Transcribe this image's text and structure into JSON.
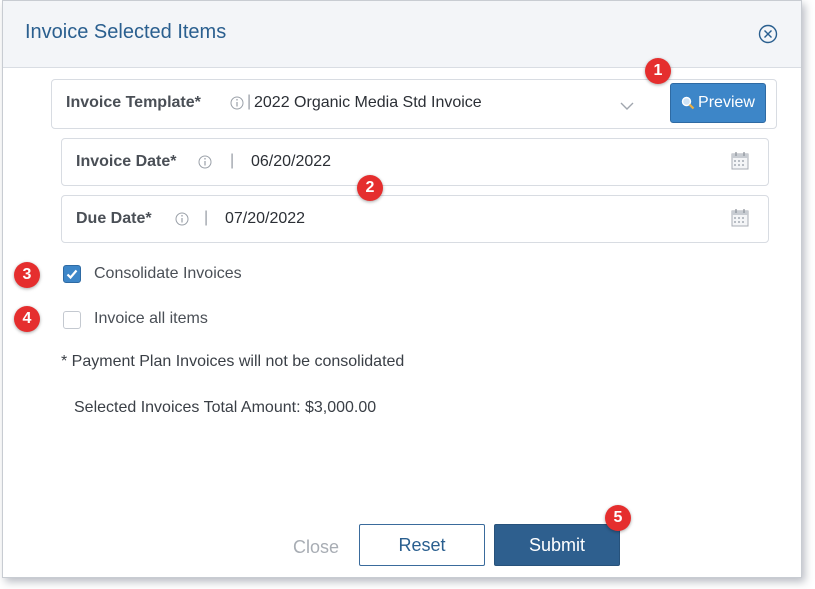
{
  "dialog": {
    "title": "Invoice Selected Items"
  },
  "template_field": {
    "label": "Invoice Template*",
    "value": "2022 Organic Media Std Invoice",
    "preview_label": "Preview"
  },
  "invoice_date": {
    "label": "Invoice Date*",
    "separator": "|",
    "value": "06/20/2022"
  },
  "due_date": {
    "label": "Due Date*",
    "separator": "|",
    "value": "07/20/2022"
  },
  "options": {
    "consolidate_label": "Consolidate Invoices",
    "consolidate_checked": true,
    "invoice_all_label": "Invoice all items",
    "invoice_all_checked": false
  },
  "notes": {
    "payment_plan": "* Payment Plan Invoices will not be consolidated",
    "total": "Selected Invoices Total Amount: $3,000.00"
  },
  "footer": {
    "close_label": "Close",
    "reset_label": "Reset",
    "submit_label": "Submit"
  },
  "badges": [
    "1",
    "2",
    "3",
    "4",
    "5"
  ],
  "colors": {
    "accent": "#3d86c8",
    "submit": "#2e5f8e",
    "title": "#2a5f8f",
    "badge": "#e52e2e"
  }
}
